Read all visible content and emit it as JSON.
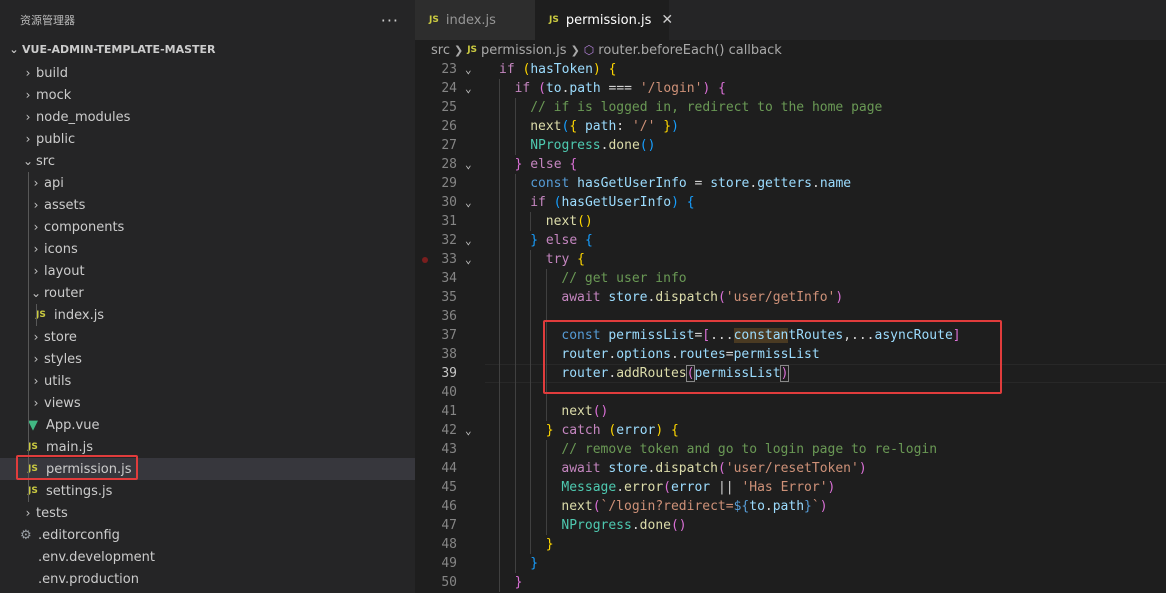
{
  "explorer": {
    "title": "资源管理器",
    "more": "···",
    "root": "VUE-ADMIN-TEMPLATE-MASTER",
    "items": [
      {
        "label": "build",
        "depth": 0,
        "kind": "folder",
        "open": false
      },
      {
        "label": "mock",
        "depth": 0,
        "kind": "folder",
        "open": false
      },
      {
        "label": "node_modules",
        "depth": 0,
        "kind": "folder",
        "open": false
      },
      {
        "label": "public",
        "depth": 0,
        "kind": "folder",
        "open": false
      },
      {
        "label": "src",
        "depth": 0,
        "kind": "folder",
        "open": true
      },
      {
        "label": "api",
        "depth": 1,
        "kind": "folder",
        "open": false
      },
      {
        "label": "assets",
        "depth": 1,
        "kind": "folder",
        "open": false
      },
      {
        "label": "components",
        "depth": 1,
        "kind": "folder",
        "open": false
      },
      {
        "label": "icons",
        "depth": 1,
        "kind": "folder",
        "open": false
      },
      {
        "label": "layout",
        "depth": 1,
        "kind": "folder",
        "open": false
      },
      {
        "label": "router",
        "depth": 1,
        "kind": "folder",
        "open": true
      },
      {
        "label": "index.js",
        "depth": 2,
        "kind": "js"
      },
      {
        "label": "store",
        "depth": 1,
        "kind": "folder",
        "open": false
      },
      {
        "label": "styles",
        "depth": 1,
        "kind": "folder",
        "open": false
      },
      {
        "label": "utils",
        "depth": 1,
        "kind": "folder",
        "open": false
      },
      {
        "label": "views",
        "depth": 1,
        "kind": "folder",
        "open": false
      },
      {
        "label": "App.vue",
        "depth": 1,
        "kind": "vue"
      },
      {
        "label": "main.js",
        "depth": 1,
        "kind": "js"
      },
      {
        "label": "permission.js",
        "depth": 1,
        "kind": "js",
        "selected": true
      },
      {
        "label": "settings.js",
        "depth": 1,
        "kind": "js"
      },
      {
        "label": "tests",
        "depth": 0,
        "kind": "folder",
        "open": false
      },
      {
        "label": ".editorconfig",
        "depth": 0,
        "kind": "gear"
      },
      {
        "label": ".env.development",
        "depth": 0,
        "kind": "env"
      },
      {
        "label": ".env.production",
        "depth": 0,
        "kind": "env"
      }
    ]
  },
  "tabs": [
    {
      "label": "index.js",
      "badge": "JS",
      "active": false
    },
    {
      "label": "permission.js",
      "badge": "JS",
      "active": true,
      "close": "✕"
    }
  ],
  "breadcrumb": {
    "src": "src",
    "file": "permission.js",
    "symbol": "router.beforeEach() callback",
    "badge": "JS"
  },
  "code": {
    "current_line": 39,
    "lines": [
      {
        "n": 23,
        "indent": 0,
        "fold": true,
        "html": "<span class='k'>if</span> <span class='br1'>(</span><span class='v'>hasToken</span><span class='br1'>)</span> <span class='br1'>{</span>"
      },
      {
        "n": 24,
        "indent": 1,
        "fold": true,
        "html": "<span class='k'>if</span> <span class='br2'>(</span><span class='v'>to</span>.<span class='v'>path</span> === <span class='s'>'/login'</span><span class='br2'>)</span> <span class='br2'>{</span>"
      },
      {
        "n": 25,
        "indent": 2,
        "html": "<span class='c'>// if is logged in, redirect to the home page</span>"
      },
      {
        "n": 26,
        "indent": 2,
        "html": "<span class='f'>next</span><span class='br3'>(</span><span class='br1'>{</span> <span class='v'>path</span>: <span class='s'>'/'</span> <span class='br1'>}</span><span class='br3'>)</span>"
      },
      {
        "n": 27,
        "indent": 2,
        "html": "<span class='cls'>NProgress</span>.<span class='f'>done</span><span class='br3'>()</span>"
      },
      {
        "n": 28,
        "indent": 1,
        "fold": true,
        "html": "<span class='br2'>}</span> <span class='k'>else</span> <span class='br2'>{</span>"
      },
      {
        "n": 29,
        "indent": 2,
        "html": "<span class='kb'>const</span> <span class='v'>hasGetUserInfo</span> = <span class='v'>store</span>.<span class='v'>getters</span>.<span class='v'>name</span>"
      },
      {
        "n": 30,
        "indent": 2,
        "fold": true,
        "html": "<span class='k'>if</span> <span class='br3'>(</span><span class='v'>hasGetUserInfo</span><span class='br3'>)</span> <span class='br3'>{</span>"
      },
      {
        "n": 31,
        "indent": 3,
        "html": "<span class='f'>next</span><span class='br1'>()</span>"
      },
      {
        "n": 32,
        "indent": 2,
        "fold": true,
        "html": "<span class='br3'>}</span> <span class='k'>else</span> <span class='br3'>{</span>"
      },
      {
        "n": 33,
        "indent": 3,
        "fold": true,
        "bp": true,
        "html": "<span class='k'>try</span> <span class='br1'>{</span>"
      },
      {
        "n": 34,
        "indent": 4,
        "html": "<span class='c'>// get user info</span>"
      },
      {
        "n": 35,
        "indent": 4,
        "html": "<span class='k'>await</span> <span class='v'>store</span>.<span class='f'>dispatch</span><span class='br2'>(</span><span class='s'>'user/getInfo'</span><span class='br2'>)</span>"
      },
      {
        "n": 36,
        "indent": 4,
        "html": ""
      },
      {
        "n": 37,
        "indent": 4,
        "html": "<span class='kb'>const</span> <span class='v'>permissList</span>=<span class='br2'>[</span>...<span class='v wordhl'>constan</span><span class='v'>tRoutes</span>,...<span class='v'>asyncRoute</span><span class='br2'>]</span>"
      },
      {
        "n": 38,
        "indent": 4,
        "html": "<span class='v'>router</span>.<span class='v'>options</span>.<span class='v'>routes</span>=<span class='v'>permissList</span>"
      },
      {
        "n": 39,
        "indent": 4,
        "html": "<span class='v'>router</span>.<span class='f'>addRoutes</span><span class='br2 bracketbox'>(</span><span class='v'>permissList</span><span class='br2 bracketbox'>)</span>"
      },
      {
        "n": 40,
        "indent": 4,
        "html": ""
      },
      {
        "n": 41,
        "indent": 4,
        "html": "<span class='f'>next</span><span class='br2'>()</span>"
      },
      {
        "n": 42,
        "indent": 3,
        "fold": true,
        "html": "<span class='br1'>}</span> <span class='k'>catch</span> <span class='br1'>(</span><span class='v'>error</span><span class='br1'>)</span> <span class='br1'>{</span>"
      },
      {
        "n": 43,
        "indent": 4,
        "html": "<span class='c'>// remove token and go to login page to re-login</span>"
      },
      {
        "n": 44,
        "indent": 4,
        "html": "<span class='k'>await</span> <span class='v'>store</span>.<span class='f'>dispatch</span><span class='br2'>(</span><span class='s'>'user/resetToken'</span><span class='br2'>)</span>"
      },
      {
        "n": 45,
        "indent": 4,
        "html": "<span class='cls'>Message</span>.<span class='f'>error</span><span class='br2'>(</span><span class='v'>error</span> || <span class='s'>'Has Error'</span><span class='br2'>)</span>"
      },
      {
        "n": 46,
        "indent": 4,
        "html": "<span class='f'>next</span><span class='br2'>(</span><span class='s'>`/login?redirect=</span><span class='kb'>${</span><span class='v'>to</span>.<span class='v'>path</span><span class='kb'>}</span><span class='s'>`</span><span class='br2'>)</span>"
      },
      {
        "n": 47,
        "indent": 4,
        "html": "<span class='cls'>NProgress</span>.<span class='f'>done</span><span class='br2'>()</span>"
      },
      {
        "n": 48,
        "indent": 3,
        "html": "<span class='br1'>}</span>"
      },
      {
        "n": 49,
        "indent": 2,
        "html": "<span class='br3'>}</span>"
      },
      {
        "n": 50,
        "indent": 1,
        "html": "<span class='br2'>}</span>"
      }
    ]
  },
  "colors": {
    "accent_box": "#e03c3c",
    "sidebar_bg": "#252526",
    "editor_bg": "#1e1e1e"
  }
}
